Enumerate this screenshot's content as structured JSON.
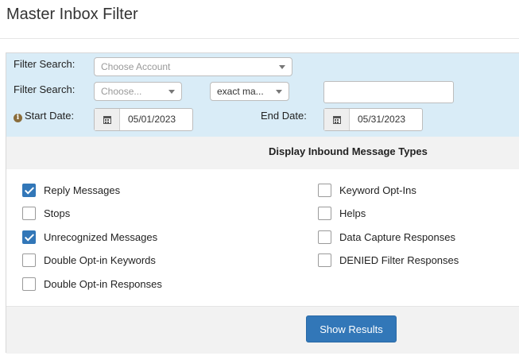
{
  "page": {
    "title": "Master Inbox Filter"
  },
  "filters": {
    "row1_label": "Filter Search:",
    "account_select": "Choose Account",
    "row2_label": "Filter Search:",
    "field_select": "Choose...",
    "match_select": "exact ma...",
    "search_value": "",
    "start_label": "Start Date:",
    "start_date": "05/01/2023",
    "end_label": "End Date:",
    "end_date": "05/31/2023"
  },
  "message_types": {
    "heading": "Display Inbound Message Types",
    "left": [
      {
        "label": "Reply Messages",
        "checked": true
      },
      {
        "label": "Stops",
        "checked": false
      },
      {
        "label": "Unrecognized Messages",
        "checked": true
      },
      {
        "label": "Double Opt-in Keywords",
        "checked": false
      },
      {
        "label": "Double Opt-in Responses",
        "checked": false
      }
    ],
    "right": [
      {
        "label": "Keyword Opt-Ins",
        "checked": false
      },
      {
        "label": "Helps",
        "checked": false
      },
      {
        "label": "Data Capture Responses",
        "checked": false
      },
      {
        "label": "DENIED Filter Responses",
        "checked": false
      }
    ]
  },
  "actions": {
    "show_results": "Show Results"
  },
  "colors": {
    "filter_bg": "#d9ecf7",
    "primary": "#3277b8",
    "band_bg": "#f2f2f2"
  }
}
